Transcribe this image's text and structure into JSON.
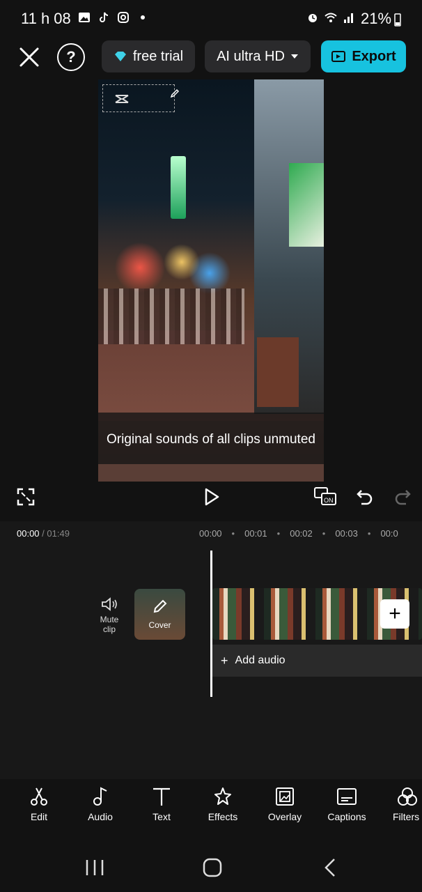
{
  "status_bar": {
    "time": "11 h 08",
    "battery": "21%"
  },
  "toolbar": {
    "trial_label": "free trial",
    "quality_label": "AI ultra HD",
    "export_label": "Export"
  },
  "preview": {
    "message": "Original sounds of all clips unmuted"
  },
  "timeline": {
    "current_time": "00:00",
    "duration": "/ 01:49",
    "ruler": [
      "00:00",
      "00:01",
      "00:02",
      "00:03",
      "00:0"
    ],
    "mute_label_line1": "Mute",
    "mute_label_line2": "clip",
    "cover_label": "Cover",
    "add_audio_label": "Add audio"
  },
  "tools": [
    {
      "label": "Edit",
      "icon": "scissors-icon"
    },
    {
      "label": "Audio",
      "icon": "music-note-icon"
    },
    {
      "label": "Text",
      "icon": "text-icon"
    },
    {
      "label": "Effects",
      "icon": "effects-star-icon"
    },
    {
      "label": "Overlay",
      "icon": "overlay-icon"
    },
    {
      "label": "Captions",
      "icon": "captions-icon"
    },
    {
      "label": "Filters",
      "icon": "filters-icon"
    }
  ],
  "colors": {
    "accent": "#17c2df",
    "background": "#121212",
    "panel": "#2a2a2c"
  }
}
